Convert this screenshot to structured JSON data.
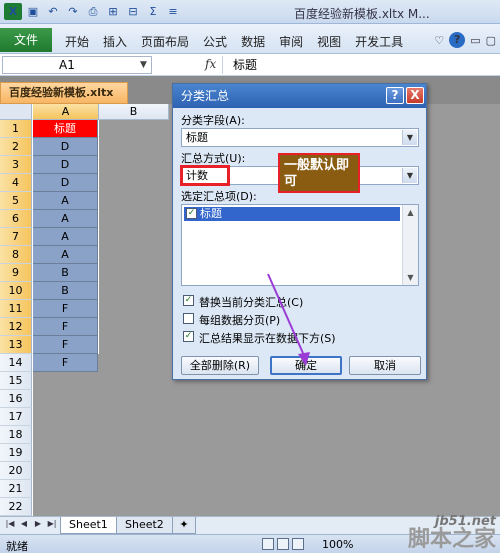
{
  "window": {
    "title": "百度经验新模板.xltx M..."
  },
  "qat": {
    "logo": "X",
    "save_icon": "save-icon",
    "undo_icon": "undo-icon",
    "redo_icon": "redo-icon"
  },
  "ribbon": {
    "file_tab": "文件",
    "tabs": [
      "开始",
      "插入",
      "页面布局",
      "公式",
      "数据",
      "审阅",
      "视图",
      "开发工具"
    ],
    "help": "?"
  },
  "formula_bar": {
    "name_box": "A1",
    "fx": "fx",
    "content": "标题"
  },
  "workbook_tab": "百度经验新模板.xltx",
  "sheet": {
    "columns": [
      "A",
      "B"
    ],
    "rows": [
      "1",
      "2",
      "3",
      "4",
      "5",
      "6",
      "7",
      "8",
      "9",
      "10",
      "11",
      "12",
      "13",
      "14",
      "15",
      "16",
      "17",
      "18",
      "19",
      "20",
      "21",
      "22",
      "23"
    ],
    "column_a_values": [
      "标题",
      "D",
      "D",
      "D",
      "A",
      "A",
      "A",
      "A",
      "B",
      "B",
      "F",
      "F",
      "F",
      "F"
    ]
  },
  "dialog": {
    "title": "分类汇总",
    "help_btn": "?",
    "close_btn": "X",
    "group_by_label": "分类字段(A):",
    "group_by_value": "标题",
    "function_label": "汇总方式(U):",
    "function_value": "计数",
    "subtotal_label": "选定汇总项(D):",
    "subtotal_items": [
      "标题"
    ],
    "options": [
      {
        "label": "替换当前分类汇总(C)",
        "checked": true
      },
      {
        "label": "每组数据分页(P)",
        "checked": false
      },
      {
        "label": "汇总结果显示在数据下方(S)",
        "checked": true
      }
    ],
    "buttons": {
      "remove_all": "全部删除(R)",
      "ok": "确定",
      "cancel": "取消"
    }
  },
  "annotation": {
    "note": "一般默认即可",
    "color": "#e8202a",
    "arrow_color": "#9b3bd6"
  },
  "sheet_tabs": [
    "Sheet1",
    "Sheet2"
  ],
  "status": {
    "ready": "就绪",
    "zoom": "100%"
  },
  "watermark": {
    "line1": "jb51.net",
    "line2": "脚本之家"
  }
}
